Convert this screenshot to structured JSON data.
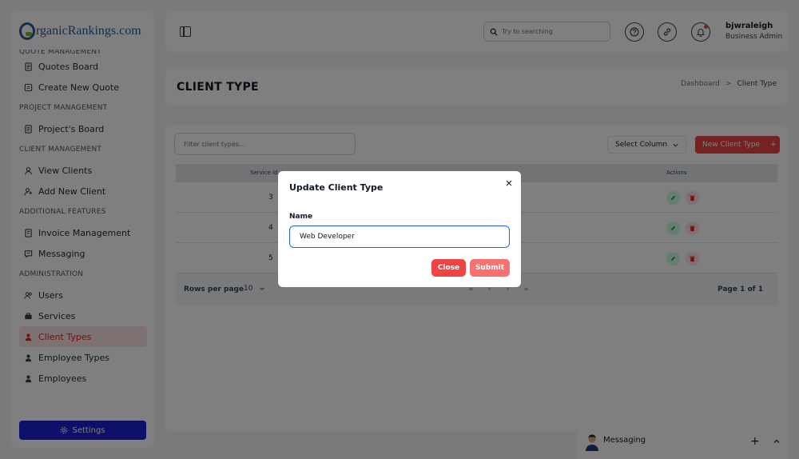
{
  "colors": {
    "accent": "#ef4444",
    "settings": "#1d1dd6",
    "active_bg": "#fde2e2",
    "focus": "#2563eb",
    "logo_blue": "#2b5d8f",
    "logo_green": "#7cb342"
  },
  "logo": {
    "text": "rganicRankings.com"
  },
  "sidebar": {
    "sections": [
      {
        "label": "QUOTE MANAGEMENT",
        "items": [
          {
            "label": "Quotes Board",
            "icon": "document-icon"
          },
          {
            "label": "Create New Quote",
            "icon": "document-plus-icon"
          }
        ]
      },
      {
        "label": "PROJECT MANAGEMENT",
        "items": [
          {
            "label": "Project's Board",
            "icon": "document-icon"
          }
        ]
      },
      {
        "label": "CLIENT MANAGEMENT",
        "items": [
          {
            "label": "View Clients",
            "icon": "user-icon"
          },
          {
            "label": "Add New Client",
            "icon": "user-plus-icon"
          }
        ]
      },
      {
        "label": "ADDITIONAL FEATURES",
        "items": [
          {
            "label": "Invoice Management",
            "icon": "invoice-icon"
          },
          {
            "label": "Messaging",
            "icon": "chat-icon"
          }
        ]
      },
      {
        "label": "ADMINISTRATION",
        "items": [
          {
            "label": "Users",
            "icon": "users-icon"
          },
          {
            "label": "Services",
            "icon": "briefcase-icon"
          },
          {
            "label": "Client Types",
            "icon": "user-solid-icon",
            "active": true
          },
          {
            "label": "Employee Types",
            "icon": "user-solid-icon"
          },
          {
            "label": "Employees",
            "icon": "user-solid-icon"
          }
        ]
      }
    ],
    "settings_label": "Settings"
  },
  "header": {
    "search_placeholder": "Try to searching",
    "user_name": "bjwraleigh",
    "user_role": "Business Admin"
  },
  "page": {
    "title": "CLIENT TYPE",
    "breadcrumb": [
      "Dashboard",
      "Client Type"
    ],
    "breadcrumb_sep": ">"
  },
  "toolbar": {
    "filter_placeholder": "Filter client types...",
    "select_column": "Select Column",
    "new_button": "New Client Type",
    "new_button_plus": "+"
  },
  "table": {
    "columns": [
      "Service Id",
      "Actions"
    ],
    "rows": [
      {
        "id": "3"
      },
      {
        "id": "4"
      },
      {
        "id": "5"
      }
    ],
    "rows_per_page_label": "Rows per page",
    "rows_per_page": "10",
    "pager": [
      "«",
      "‹",
      "›",
      "»"
    ],
    "page_info": "Page 1 of 1"
  },
  "messaging": {
    "title": "Messaging",
    "plus": "+"
  },
  "modal": {
    "title": "Update Client Type",
    "name_label": "Name",
    "name_value": "Web Developer",
    "close_label": "Close",
    "submit_label": "Submit"
  }
}
